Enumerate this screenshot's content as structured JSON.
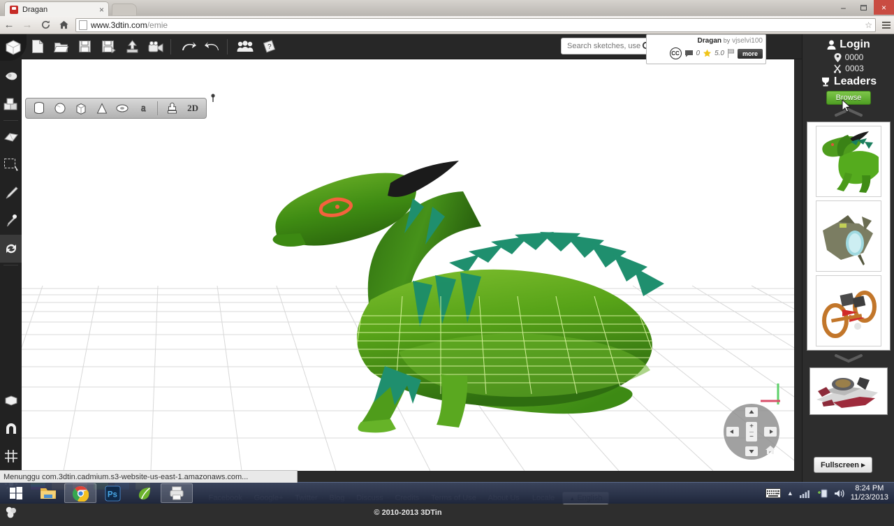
{
  "browser": {
    "tab": {
      "title": "Dragan",
      "close_label": "×",
      "favicon": "dragon-favicon"
    },
    "window_controls": {
      "minimize": "–",
      "maximize": "❐",
      "close": "×"
    },
    "nav": {
      "back": "←",
      "forward": "→",
      "reload": "↻",
      "home": "⌂"
    },
    "url": {
      "host": "www.3dtin.com",
      "path": "/emie"
    },
    "bookmark_star": "☆"
  },
  "app": {
    "toolbar": [
      {
        "name": "new-file",
        "label": "New"
      },
      {
        "name": "open-file",
        "label": "Open"
      },
      {
        "name": "save-file",
        "label": "Save"
      },
      {
        "name": "save-as-file",
        "label": "Save As"
      },
      {
        "name": "export-upload",
        "label": "Export"
      },
      {
        "name": "record-video",
        "label": "Record"
      },
      {
        "name": "undo",
        "label": "Undo"
      },
      {
        "name": "redo",
        "label": "Redo"
      },
      {
        "name": "community",
        "label": "Community"
      },
      {
        "name": "help",
        "label": "Help"
      }
    ],
    "left_tools": [
      {
        "name": "cube-tool",
        "label": "Cube"
      },
      {
        "name": "paint-tool",
        "label": "Paint"
      },
      {
        "name": "blocks-tool",
        "label": "Blocks"
      },
      {
        "name": "eraser-tool",
        "label": "Eraser"
      },
      {
        "name": "select-tool",
        "label": "Select"
      },
      {
        "name": "brush-tool",
        "label": "Brush"
      },
      {
        "name": "eyedropper-tool",
        "label": "Eyedropper"
      },
      {
        "name": "rotate-tool",
        "label": "Rotate"
      },
      {
        "name": "plane-tool",
        "label": "Plane"
      },
      {
        "name": "magnet-tool",
        "label": "Snap"
      },
      {
        "name": "grid-tool",
        "label": "Grid"
      },
      {
        "name": "light-tool",
        "label": "Light"
      },
      {
        "name": "material-tool",
        "label": "Material"
      }
    ],
    "shape_toolbar": {
      "shapes": [
        {
          "name": "cylinder-shape",
          "label": "Cylinder"
        },
        {
          "name": "sphere-shape",
          "label": "Sphere"
        },
        {
          "name": "box-shape",
          "label": "Box"
        },
        {
          "name": "cone-shape",
          "label": "Cone"
        },
        {
          "name": "torus-shape",
          "label": "Torus"
        },
        {
          "name": "text-shape",
          "label": "a"
        }
      ],
      "stamp_label": "Stamp",
      "mode_2d_label": "2D"
    },
    "search": {
      "placeholder": "Search sketches, users...",
      "value": ""
    },
    "info_card": {
      "title": "Dragan",
      "by_label": "by",
      "author": "vjselvi100",
      "license": "CC",
      "comments": "0",
      "rating": "5.0",
      "more_label": "more"
    },
    "nav_wheel": {
      "up": "▲",
      "down": "▼",
      "left": "◀",
      "right": "▶",
      "zoom_in": "+",
      "zoom_out": "−",
      "home": "⌂"
    },
    "axis": {
      "x_color": "#d94f6a",
      "y_color": "#5ed16a"
    },
    "palette": [
      {
        "name": "rainbow-swatch",
        "color": "rainbow"
      },
      {
        "name": "orange-swatch",
        "color": "#cf8c22"
      },
      {
        "name": "red-swatch",
        "color": "#f74b4b"
      },
      {
        "name": "green-swatch",
        "color": "#57e315"
      },
      {
        "name": "blue-swatch",
        "color": "#1778e0"
      },
      {
        "name": "yellow-swatch",
        "color": "#f7f35c"
      }
    ],
    "footer": {
      "links": [
        "Facebook",
        "Google+",
        "Twitter",
        "Blog",
        "Discuss",
        "Credits",
        "Terms of Use",
        "About Us"
      ],
      "locale_label": "Locale",
      "language": "English",
      "copyright": "© 2010-2013 3DTin"
    }
  },
  "sidebar": {
    "login_label": "Login",
    "stat_views": "0000",
    "stat_forks": "0003",
    "leaders_label": "Leaders",
    "browse_label": "Browse",
    "scroll_up": "scroll-up",
    "scroll_down": "scroll-down",
    "thumbnails": [
      {
        "name": "thumbnail-dragon",
        "label": "Dragon model"
      },
      {
        "name": "thumbnail-alien-ship",
        "label": "Alien ship model"
      },
      {
        "name": "thumbnail-wheel-machine",
        "label": "Wheel machine model"
      }
    ],
    "featured": {
      "name": "thumbnail-starfighter",
      "label": "Starfighter model"
    },
    "fullscreen_label": "Fullscreen",
    "fullscreen_arrow": "▸"
  },
  "status_bar": {
    "text": "Menunggu com.3dtin.cadmium.s3-website-us-east-1.amazonaws.com..."
  },
  "taskbar": {
    "apps": [
      {
        "name": "start-button",
        "label": "Start"
      },
      {
        "name": "file-explorer",
        "label": "File Explorer"
      },
      {
        "name": "chrome-app",
        "label": "Google Chrome"
      },
      {
        "name": "photoshop-app",
        "label": "Ps"
      },
      {
        "name": "leaf-app",
        "label": "App"
      },
      {
        "name": "printer-app",
        "label": "App"
      }
    ],
    "tray": {
      "keyboard": "keyboard-icon",
      "show_hidden": "▲",
      "network": "network-icon",
      "wifi": "wifi-icon",
      "volume": "volume-icon"
    },
    "time": "8:24 PM",
    "date": "11/23/2013"
  }
}
